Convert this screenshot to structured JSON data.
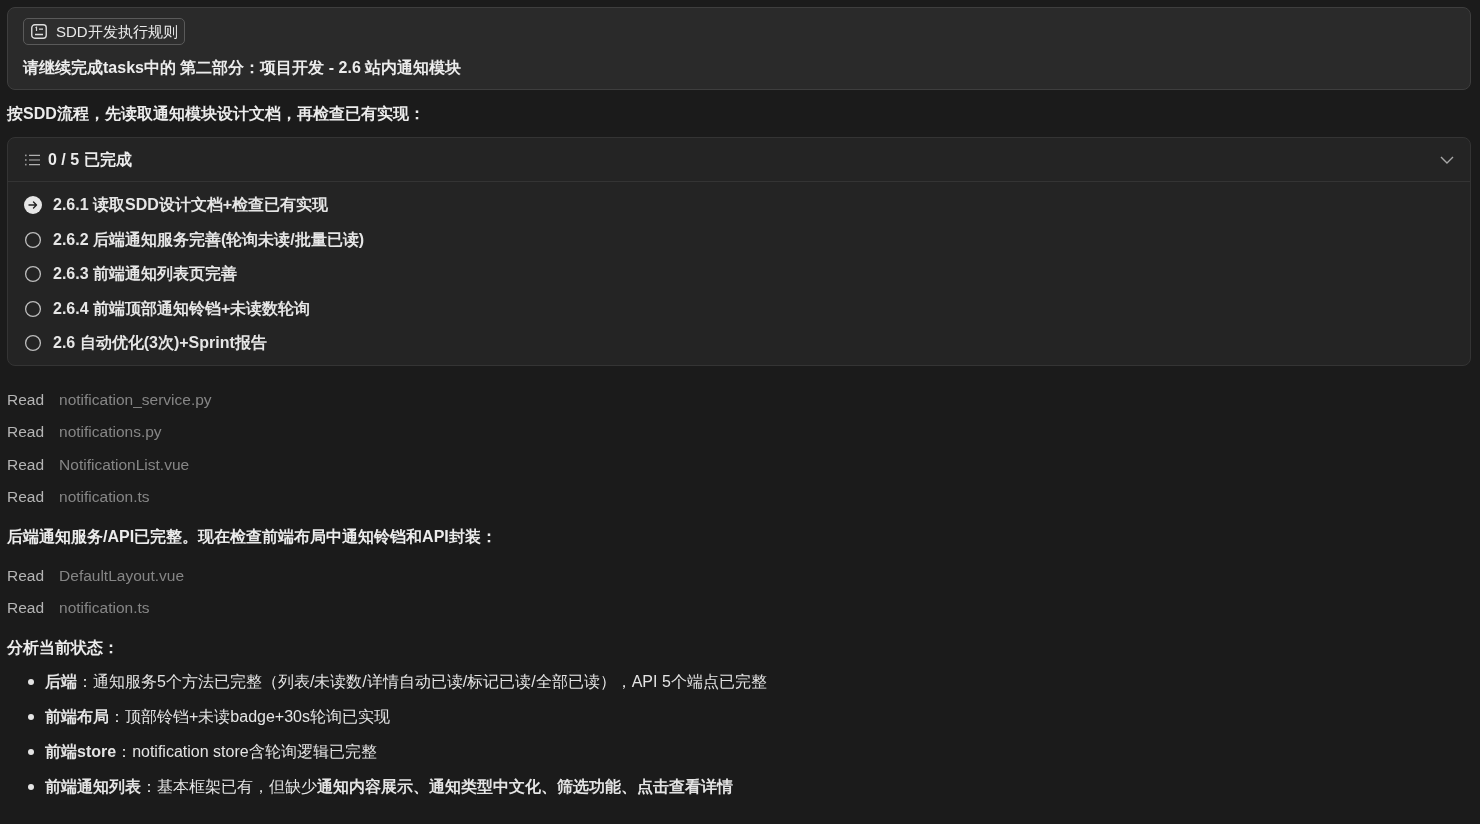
{
  "user_message": {
    "chip": {
      "label": "SDD开发执行规则"
    },
    "text": "请继续完成tasks中的 第二部分：项目开发 - 2.6 站内通知模块"
  },
  "blocks": [
    {
      "kind": "paragraph",
      "text": "按SDD流程，先读取通知模块设计文档，再检查已有实现："
    },
    {
      "kind": "todo",
      "summary": "0 / 5 已完成",
      "expanded": true,
      "items": [
        {
          "label": "2.6.1 读取SDD设计文档+检查已有实现",
          "current": true
        },
        {
          "label": "2.6.2 后端通知服务完善(轮询未读/批量已读)",
          "current": false
        },
        {
          "label": "2.6.3 前端通知列表页完善",
          "current": false
        },
        {
          "label": "2.6.4 前端顶部通知铃铛+未读数轮询",
          "current": false
        },
        {
          "label": "2.6 自动优化(3次)+Sprint报告",
          "current": false
        }
      ]
    },
    {
      "kind": "tool_call",
      "action": "Read",
      "target": "notification_service.py"
    },
    {
      "kind": "tool_call",
      "action": "Read",
      "target": "notifications.py"
    },
    {
      "kind": "tool_call",
      "action": "Read",
      "target": "NotificationList.vue"
    },
    {
      "kind": "tool_call",
      "action": "Read",
      "target": "notification.ts"
    },
    {
      "kind": "paragraph",
      "text": "后端通知服务/API已完整。现在检查前端布局中通知铃铛和API封装："
    },
    {
      "kind": "tool_call",
      "action": "Read",
      "target": "DefaultLayout.vue"
    },
    {
      "kind": "tool_call",
      "action": "Read",
      "target": "notification.ts"
    },
    {
      "kind": "paragraph",
      "text": "分析当前状态："
    },
    {
      "kind": "bullets",
      "items": [
        "**后端**：通知服务5个方法已完整（列表/未读数/详情自动已读/标记已读/全部已读），API 5个端点已完整",
        "**前端布局**：顶部铃铛+未读badge+30s轮询已实现",
        "**前端store**：notification store含轮询逻辑已完整",
        "**前端通知列表**：基本框架已有，但缺少**通知内容展示、通知类型中文化、筛选功能、点击查看详情**"
      ]
    }
  ]
}
